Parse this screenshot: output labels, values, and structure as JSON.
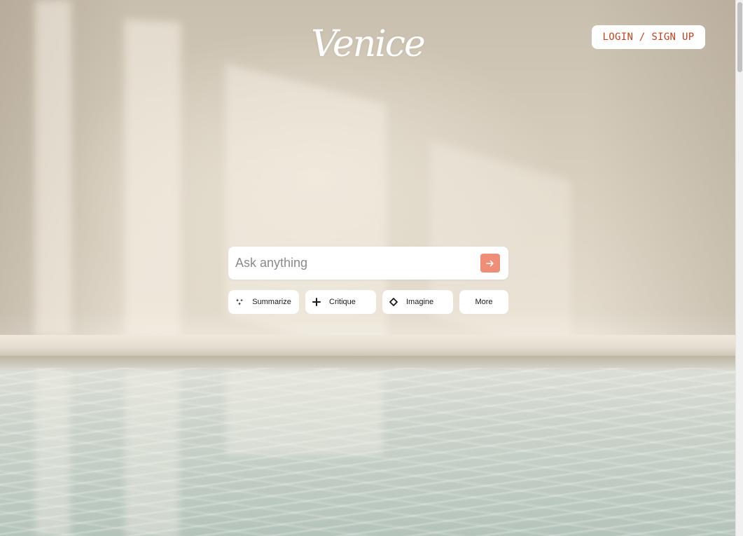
{
  "header": {
    "logo_text": "Venice",
    "login_label": "LOGIN / SIGN UP"
  },
  "search": {
    "placeholder": "Ask anything",
    "value": ""
  },
  "chips": [
    {
      "label": "Summarize",
      "icon": "sparkle-icon"
    },
    {
      "label": "Critique",
      "icon": "plus-icon"
    },
    {
      "label": "Imagine",
      "icon": "diamond-icon"
    },
    {
      "label": "More"
    }
  ],
  "colors": {
    "accent": "#ee8e76",
    "login_text": "#c8401a"
  }
}
